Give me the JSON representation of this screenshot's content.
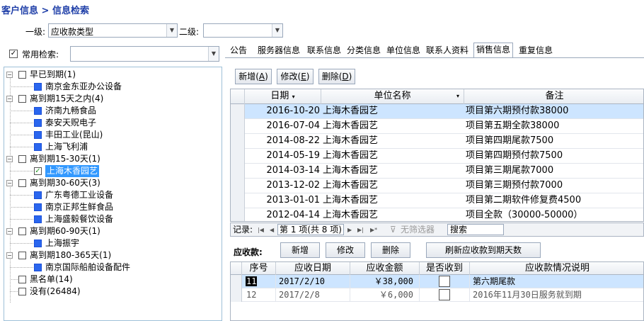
{
  "breadcrumb": "客户信息 > 信息检索",
  "level1": {
    "label": "一级:",
    "value": "应收款类型"
  },
  "level2": {
    "label": "二级:",
    "value": ""
  },
  "common_search": {
    "label": "常用检索:",
    "value": ""
  },
  "tree": {
    "nodes": [
      {
        "label": "早已到期(1)"
      },
      {
        "label": "南京金东亚办公设备"
      },
      {
        "label": "离到期15天之内(4)"
      },
      {
        "label": "济南九畅食品"
      },
      {
        "label": "泰安天贶电子"
      },
      {
        "label": "丰田工业(昆山)"
      },
      {
        "label": "上海飞利浦"
      },
      {
        "label": "离到期15-30天(1)"
      },
      {
        "label": "上海木香园艺"
      },
      {
        "label": "离到期30-60天(3)"
      },
      {
        "label": "广东粤德工业设备"
      },
      {
        "label": "南京正邦生鲜食品"
      },
      {
        "label": "上海盛毅餐饮设备"
      },
      {
        "label": "离到期60-90天(1)"
      },
      {
        "label": "上海振宇"
      },
      {
        "label": "离到期180-365天(1)"
      },
      {
        "label": "南京国际船舶设备配件"
      },
      {
        "label": "黑名单(14)"
      },
      {
        "label": "没有(26484)"
      }
    ]
  },
  "tabs": [
    "公告",
    "服务器信息",
    "联系信息",
    "分类信息",
    "单位信息",
    "联系人资料",
    "销售信息",
    "重复信息"
  ],
  "toolbar": {
    "add": "新增(",
    "add_key": "A",
    "add_end": ")",
    "edit": "修改(",
    "edit_key": "E",
    "edit_end": ")",
    "del": "删除(",
    "del_key": "D",
    "del_end": ")"
  },
  "sales_grid": {
    "headers": {
      "date": "日期",
      "company": "单位名称",
      "note": "备注"
    },
    "rows": [
      {
        "date": "2016-10-20",
        "company": "上海木香园艺",
        "note": "项目第六期预付款38000"
      },
      {
        "date": "2016-07-04",
        "company": "上海木香园艺",
        "note": "项目第五期全款38000"
      },
      {
        "date": "2014-08-22",
        "company": "上海木香园艺",
        "note": "项目第四期尾款7500"
      },
      {
        "date": "2014-05-19",
        "company": "上海木香园艺",
        "note": "项目第四期预付款7500"
      },
      {
        "date": "2014-03-14",
        "company": "上海木香园艺",
        "note": "项目第三期尾款7000"
      },
      {
        "date": "2013-12-02",
        "company": "上海木香园艺",
        "note": "项目第三期预付款7000"
      },
      {
        "date": "2013-01-01",
        "company": "上海木香园艺",
        "note": "项目第二期软件修复费4500"
      },
      {
        "date": "2012-04-14",
        "company": "上海木香园艺",
        "note": "项目全款（30000-50000）"
      }
    ]
  },
  "navigator": {
    "record_label": "记录:",
    "position": "第 1 项(共 8 项)",
    "no_filter": "无筛选器",
    "search": "搜索"
  },
  "receivable": {
    "label": "应收款:",
    "buttons": {
      "add": "新增",
      "edit": "修改",
      "delete": "删除",
      "refresh": "刷新应收款到期天数"
    },
    "headers": {
      "seq": "序号",
      "date": "应收日期",
      "amount": "应收金额",
      "received": "是否收到",
      "desc": "应收款情况说明"
    },
    "rows": [
      {
        "seq": "11",
        "date": "2017/2/10",
        "amount": "￥38,000",
        "received": false,
        "desc": "第六期尾款"
      },
      {
        "seq": "12",
        "date": "2017/2/8",
        "amount": "￥6,000",
        "received": false,
        "desc": "2016年11月30日服务就到期"
      }
    ]
  },
  "colors": {
    "breadcrumb": "#1f3fa8",
    "selection": "#cde5ff",
    "tree_selection": "#3399ff",
    "node_icon": "#2a66ee"
  }
}
